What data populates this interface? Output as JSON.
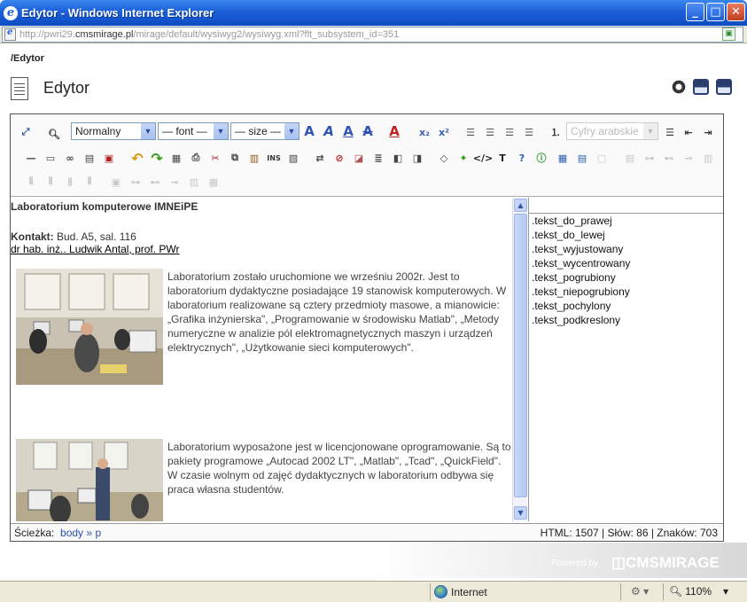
{
  "window": {
    "title": "Edytor - Windows Internet Explorer",
    "min": "_",
    "max": "□",
    "close": "✕"
  },
  "address": {
    "prefix": "http://pwri29.",
    "host": "cmsmirage.pl",
    "path": "/mirage/default/wysiwyg2/wysiwyg.xml?flt_subsystem_id=351"
  },
  "breadcrumb": "/Edytor",
  "page": {
    "title": "Edytor"
  },
  "toolbar": {
    "format_select": "Normalny",
    "font_select": "— font —",
    "size_select": "— size —",
    "list_select": "Cyfry arabskie"
  },
  "content": {
    "heading": "Laboratorium komputerowe IMNEiPE",
    "contact_label": "Kontakt:",
    "contact_value": " Bud. A5, sal. 116",
    "author": "dr hab. inż.. Ludwik Antal, prof. PWr",
    "para1": "Laboratorium zostało uruchomione we wrześniu 2002r. Jest to laboratorium dydaktyczne posiadające 19 stanowisk komputerowych. W  laboratorium realizowane są cztery przedmioty masowe, a mianowicie: „Grafika inżynierska\", „Programowanie w środowisku Matlab\", „Metody numeryczne w analizie pól elektromagnetycznych maszyn i urządzeń elektrycznych\", „Użytkowanie sieci komputerowych\".",
    "para2": "Laboratorium wyposażone jest w licencjonowane oprogramowanie. Są to pakiety programowe „Autocad 2002 LT\", „Matlab\", „Tcad\", „QuickField\". W czasie wolnym od zajęć dydaktycznych w laboratorium odbywa się praca własna studentów."
  },
  "styles": [
    ".tekst_do_prawej",
    ".tekst_do_lewej",
    ".tekst_wyjustowany",
    ".tekst_wycentrowany",
    ".tekst_pogrubiony",
    ".tekst_niepogrubiony",
    ".tekst_pochylony",
    ".tekst_podkreslony"
  ],
  "statusbar": {
    "path_label": "Ścieżka:",
    "path_body": "body",
    "path_sep": "»",
    "path_p": "p",
    "stats": "HTML: 1507 | Słów: 86 | Znaków: 703"
  },
  "footer": {
    "powered": "Powered by",
    "logo": "◫CMSMIRAGE"
  },
  "ie_status": {
    "zone": "Internet",
    "zoom": "110%"
  },
  "colors": {
    "title_blue": "#1b5fd8",
    "accent": "#3a5fb0"
  }
}
